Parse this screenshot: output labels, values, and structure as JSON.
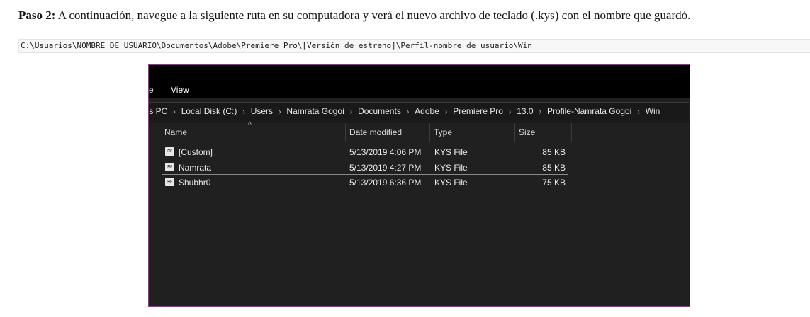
{
  "instruction": {
    "step_label": "Paso 2:",
    "text": " A continuación, navegue a la siguiente ruta en su computadora y verá el nuevo archivo de teclado (.kys) con el nombre que guardó."
  },
  "path_code": "C:\\Usuarios\\NOMBRE DE USUARIO\\Documentos\\Adobe\\Premiere Pro\\[Versión de estreno]\\Perfil-nombre de usuario\\Win",
  "explorer": {
    "ribbon": {
      "truncated_tab": "e",
      "view_tab": "View"
    },
    "breadcrumb": [
      "his PC",
      "Local Disk (C:)",
      "Users",
      "Namrata Gogoi",
      "Documents",
      "Adobe",
      "Premiere Pro",
      "13.0",
      "Profile-Namrata Gogoi",
      "Win"
    ],
    "columns": {
      "name": "Name",
      "date": "Date modified",
      "type": "Type",
      "size": "Size"
    },
    "files": [
      {
        "name": "[Custom]",
        "date": "5/13/2019 4:06 PM",
        "type": "KYS File",
        "size": "85 KB",
        "icon": "kys-file-icon",
        "selected": false
      },
      {
        "name": "Namrata",
        "date": "5/13/2019 4:27 PM",
        "type": "KYS File",
        "size": "85 KB",
        "icon": "kys-file-icon",
        "selected": true
      },
      {
        "name": "Shubhr0",
        "date": "5/13/2019 6:36 PM",
        "type": "KYS File",
        "size": "75 KB",
        "icon": "kys-file-icon",
        "selected": false
      }
    ]
  },
  "colors": {
    "explorer_bg": "#202020",
    "ribbon_bg": "#000000",
    "frame_border": "#9c2f9c",
    "selection_border": "#8a8a8a"
  }
}
